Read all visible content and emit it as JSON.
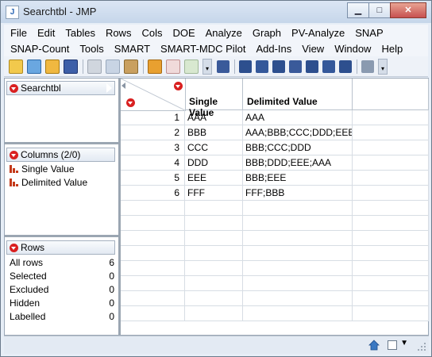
{
  "window": {
    "title": "Searchtbl - JMP",
    "icon": "jmp-app-icon"
  },
  "menu_rows": [
    [
      "File",
      "Edit",
      "Tables",
      "Rows",
      "Cols",
      "DOE",
      "Analyze",
      "Graph",
      "PV-Analyze",
      "SNAP"
    ],
    [
      "SNAP-Count",
      "Tools",
      "SMART",
      "SMART-MDC Pilot",
      "Add-Ins",
      "View",
      "Window",
      "Help"
    ]
  ],
  "table_panel": {
    "label": "Searchtbl"
  },
  "columns_panel": {
    "label": "Columns (2/0)",
    "items": [
      "Single Value",
      "Delimited Value"
    ]
  },
  "rows_panel": {
    "label": "Rows",
    "stats": [
      {
        "label": "All rows",
        "value": "6"
      },
      {
        "label": "Selected",
        "value": "0"
      },
      {
        "label": "Excluded",
        "value": "0"
      },
      {
        "label": "Hidden",
        "value": "0"
      },
      {
        "label": "Labelled",
        "value": "0"
      }
    ]
  },
  "grid": {
    "headers": [
      "Single Value",
      "Delimited Value"
    ],
    "rows": [
      {
        "n": "1",
        "single": "AAA",
        "delimited": "AAA"
      },
      {
        "n": "2",
        "single": "BBB",
        "delimited": "AAA;BBB;CCC;DDD;EEE"
      },
      {
        "n": "3",
        "single": "CCC",
        "delimited": "BBB;CCC;DDD"
      },
      {
        "n": "4",
        "single": "DDD",
        "delimited": "BBB;DDD;EEE;AAA"
      },
      {
        "n": "5",
        "single": "EEE",
        "delimited": "BBB;EEE"
      },
      {
        "n": "6",
        "single": "FFF",
        "delimited": "FFF;BBB"
      }
    ]
  },
  "colors": {
    "accent_red": "#d92020",
    "titlebar": "#c6d6ea",
    "close": "#c75050"
  }
}
